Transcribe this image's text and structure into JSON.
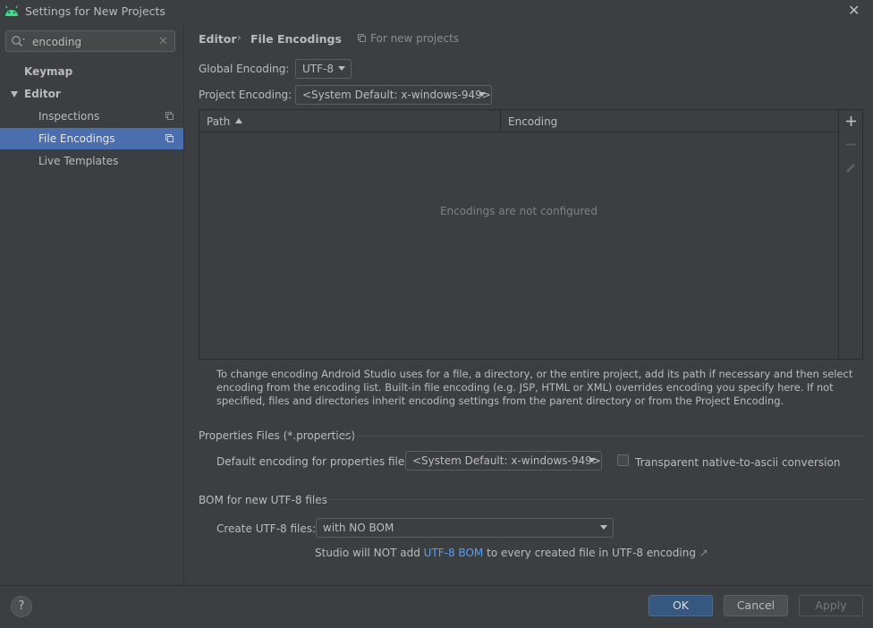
{
  "window": {
    "title": "Settings for New Projects"
  },
  "sidebar": {
    "search_value": "encoding",
    "items": [
      {
        "label": "Keymap"
      },
      {
        "label": "Editor"
      },
      {
        "label": "Inspections"
      },
      {
        "label": "File Encodings"
      },
      {
        "label": "Live Templates"
      }
    ]
  },
  "breadcrumb": {
    "parent": "Editor",
    "current": "File Encodings",
    "scope": "For new projects"
  },
  "encodings": {
    "global_label": "Global Encoding:",
    "global_value": "UTF-8",
    "project_label": "Project Encoding:",
    "project_value": "<System Default: x-windows-949>"
  },
  "table": {
    "columns": [
      "Path",
      "Encoding"
    ],
    "empty_text": "Encodings are not configured"
  },
  "help_text": "To change encoding Android Studio uses for a file, a directory, or the entire project, add its path if necessary and then select encoding from the encoding list. Built-in file encoding (e.g. JSP, HTML or XML) overrides encoding you specify here. If not specified, files and directories inherit encoding settings from the parent directory or from the Project Encoding.",
  "properties": {
    "section_title": "Properties Files (*.properties)",
    "default_label": "Default encoding for properties files:",
    "default_value": "<System Default: x-windows-949>",
    "transparent_label": "Transparent native-to-ascii conversion",
    "transparent_checked": false
  },
  "bom": {
    "section_title": "BOM for new UTF-8 files",
    "create_label": "Create UTF-8 files:",
    "create_value": "with NO BOM",
    "note_prefix": "Studio will NOT add",
    "note_link": "UTF-8 BOM",
    "note_suffix": "to every created file in UTF-8 encoding",
    "note_link_arrow": "↗"
  },
  "buttons": {
    "help": "?",
    "ok": "OK",
    "cancel": "Cancel",
    "apply": "Apply"
  },
  "colors": {
    "selection": "#4b6eaf",
    "link": "#589df6",
    "primary_button": "#365880",
    "android_green": "#3ddc84"
  }
}
